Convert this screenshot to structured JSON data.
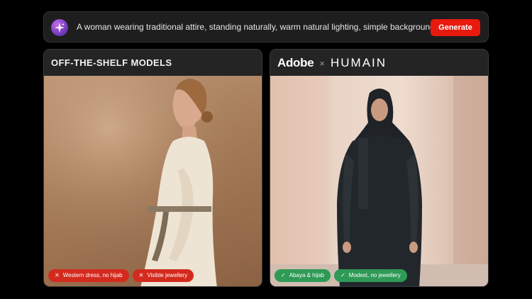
{
  "prompt": {
    "text": "A woman wearing traditional attire, standing naturally, warm natural lighting, simple background.",
    "generate_label": "Generate",
    "icon": "sparkle-icon"
  },
  "left_panel": {
    "title": "OFF-THE-SHELF MODELS",
    "tags": [
      {
        "glyph": "✕",
        "label": "Western dress, no hijab"
      },
      {
        "glyph": "✕",
        "label": "Visible jewellery"
      }
    ]
  },
  "right_panel": {
    "brand_left": "Adobe",
    "brand_separator": "×",
    "brand_right": "HUMAIN",
    "tags": [
      {
        "glyph": "✓",
        "label": "Abaya & hijab"
      },
      {
        "glyph": "✓",
        "label": "Modest, no jewellery"
      }
    ]
  },
  "colors": {
    "accent": "#e81a0d",
    "tag_bad": "#d42a1e",
    "tag_good": "#2e9a56"
  }
}
